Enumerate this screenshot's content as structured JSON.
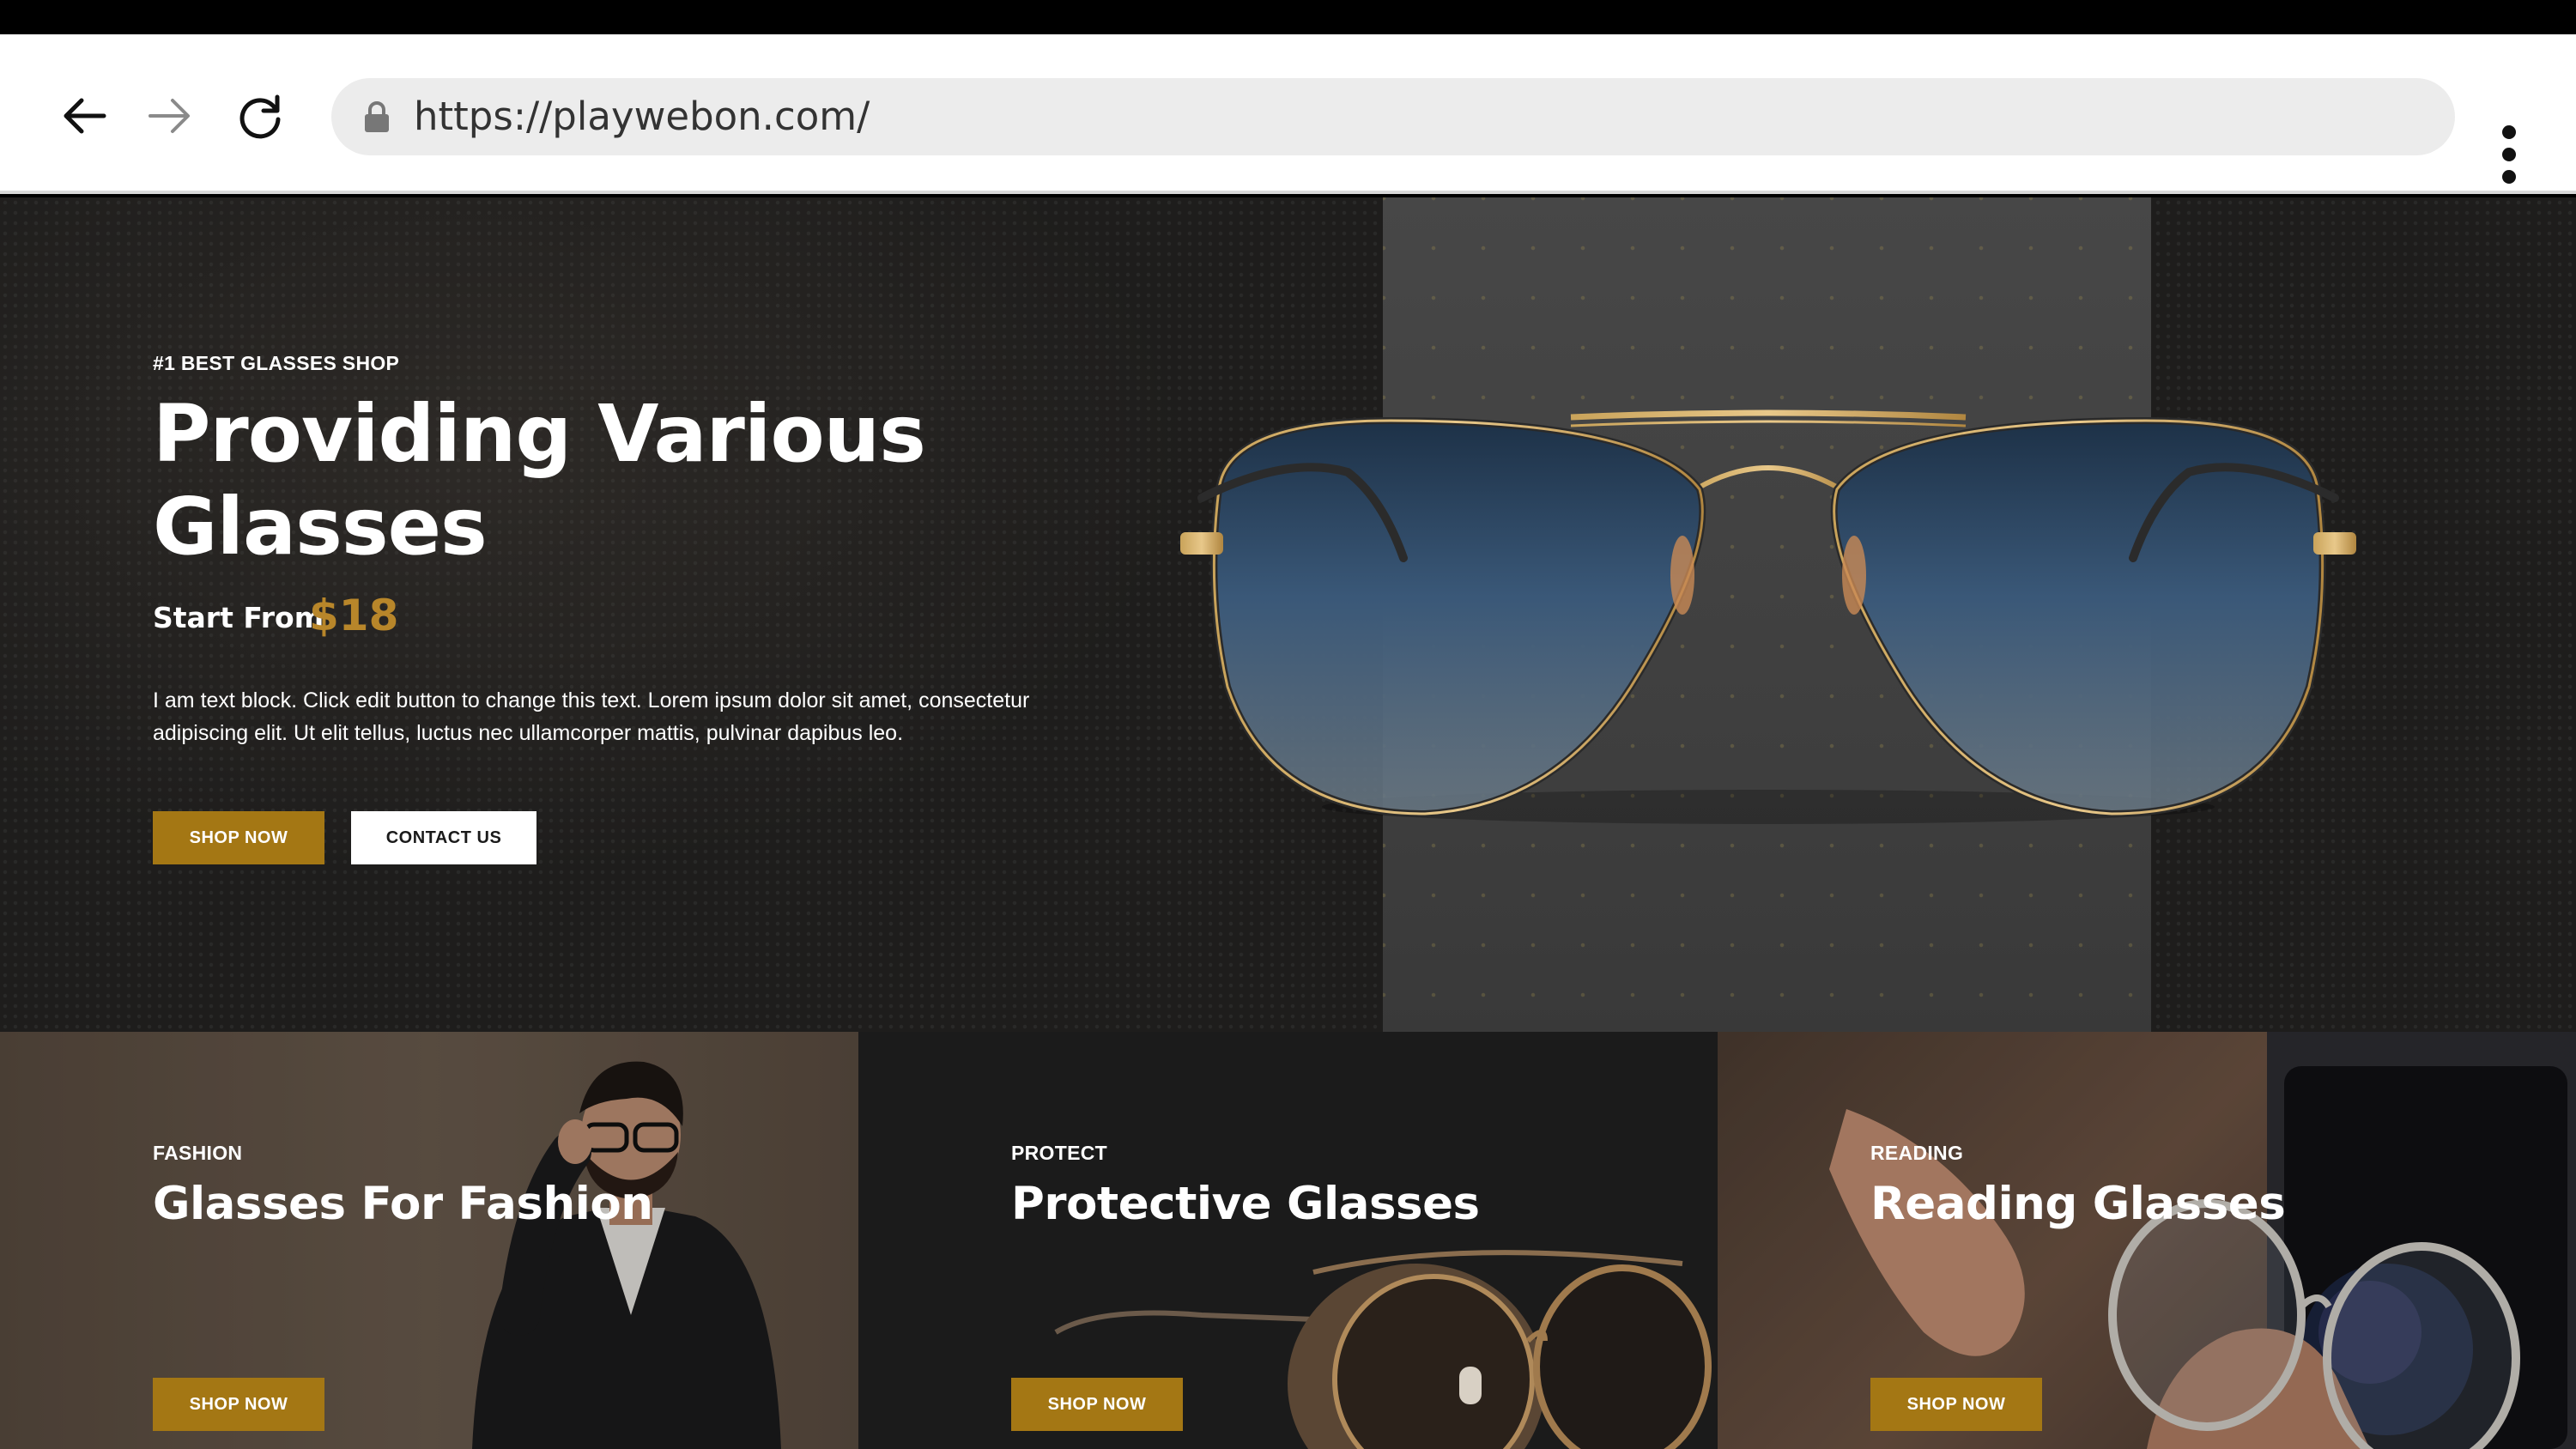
{
  "browser": {
    "url": "https://playwebon.com/",
    "icons": [
      "back-arrow-icon",
      "forward-arrow-icon",
      "reload-icon",
      "lock-icon",
      "more-vert-icon"
    ]
  },
  "hero": {
    "kicker": "#1 BEST GLASSES SHOP",
    "title": "Providing Various Glasses",
    "price_label": "Start From",
    "price": "$18",
    "body": "I am text block. Click edit button to change this text. Lorem ipsum dolor sit amet, consectetur adipiscing elit. Ut elit tellus, luctus nec ullamcorper mattis, pulvinar dapibus leo.",
    "shop_label": "SHOP NOW",
    "contact_label": "CONTACT US"
  },
  "cards": [
    {
      "kicker": "FASHION",
      "title": "Glasses For Fashion",
      "button": "SHOP NOW"
    },
    {
      "kicker": "PROTECT",
      "title": "Protective Glasses",
      "button": "SHOP NOW"
    },
    {
      "kicker": "READING",
      "title": "Reading Glasses",
      "button": "SHOP NOW"
    }
  ],
  "colors": {
    "accent": "#a47714",
    "price": "#b8862a",
    "hero_bg": "#1e1d1c",
    "panel": "#444444"
  }
}
